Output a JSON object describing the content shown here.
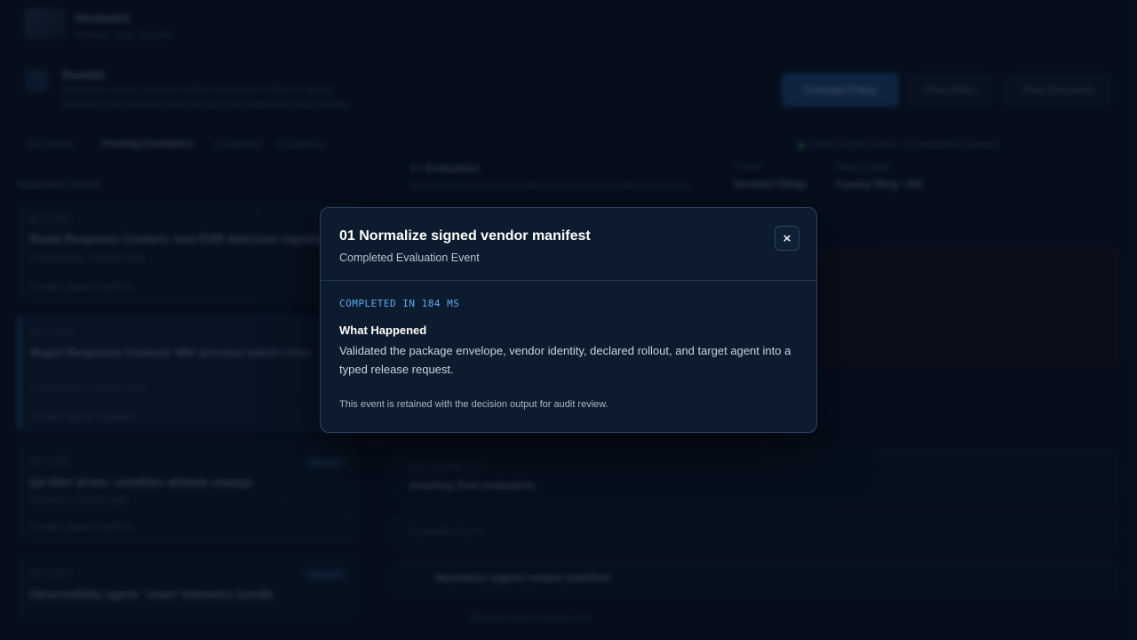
{
  "background": {
    "brand_name": "Verdantix",
    "brand_tagline": "Release Gate Console",
    "page_title": "Rootkit",
    "page_desc_line1": "Evaluates vendor packages before production rollout to agents.",
    "page_desc_line2": "Decisions are recorded with full trace and retained for audit review.",
    "primary_action": "Evaluate Policy",
    "secondary_action_1": "View Rules",
    "secondary_action_2": "View Decisions",
    "tabs": [
      "All Policies",
      "Pending Evaluation",
      "Completed",
      "Exceptions"
    ],
    "system_status": "Policy engine online • 4 evaluations queued",
    "queue_heading": "Evaluation Queue",
    "queue_items": [
      {
        "tag": "ALT-1782",
        "title": "Rapid Response Content: new EDR detection signatures",
        "meta": "CrowdStrike • Sensor fleet",
        "footer": "Vendor-signed manifest"
      },
      {
        "tag": "ALT-1783",
        "title": "Rapid Response Content: Win process watch rules",
        "meta": "CrowdStrike • Sensor fleet",
        "footer": "Vendor-signed manifest"
      },
      {
        "tag": "ALT-2051",
        "title": "Q4 filter driver: minifilter altitude change",
        "meta": "Windows • Kernel path",
        "footer": "Vendor-signed manifest",
        "badge": "Queued"
      },
      {
        "tag": "ALT-2063",
        "title": "Observability agent: 'clean' telemetry bundle",
        "meta": "",
        "footer": "",
        "badge": "Queued"
      }
    ],
    "detail_title": "1 • Evaluation",
    "detail_desc": "Deterministic checks run before any production rollout is allowed.",
    "detail_owner_label": "Owner",
    "detail_owner": "Sentinel Ridge",
    "detail_stage_label": "Target Stage",
    "detail_stage": "Canary Ring • 5%",
    "decision_label": "Decision Record",
    "decision_value": "Awaiting final evaluation",
    "timeline_label": "Evaluation Trace",
    "timeline_item": "Normalize signed vendor manifest",
    "footer_text": "Release Gate Console v2.4"
  },
  "modal": {
    "title": "01 Normalize signed vendor manifest",
    "subtitle": "Completed Evaluation Event",
    "close_label": "×",
    "status_line": "COMPLETED IN 184 MS",
    "section_heading": "What Happened",
    "section_text": "Validated the package envelope, vendor identity, declared rollout, and target agent into a typed release request.",
    "footnote": "This event is retained with the decision output for audit review."
  },
  "colors": {
    "accent": "#5fa9f0",
    "modal_bg": "#0d1b2e",
    "page_bg": "#081222"
  }
}
